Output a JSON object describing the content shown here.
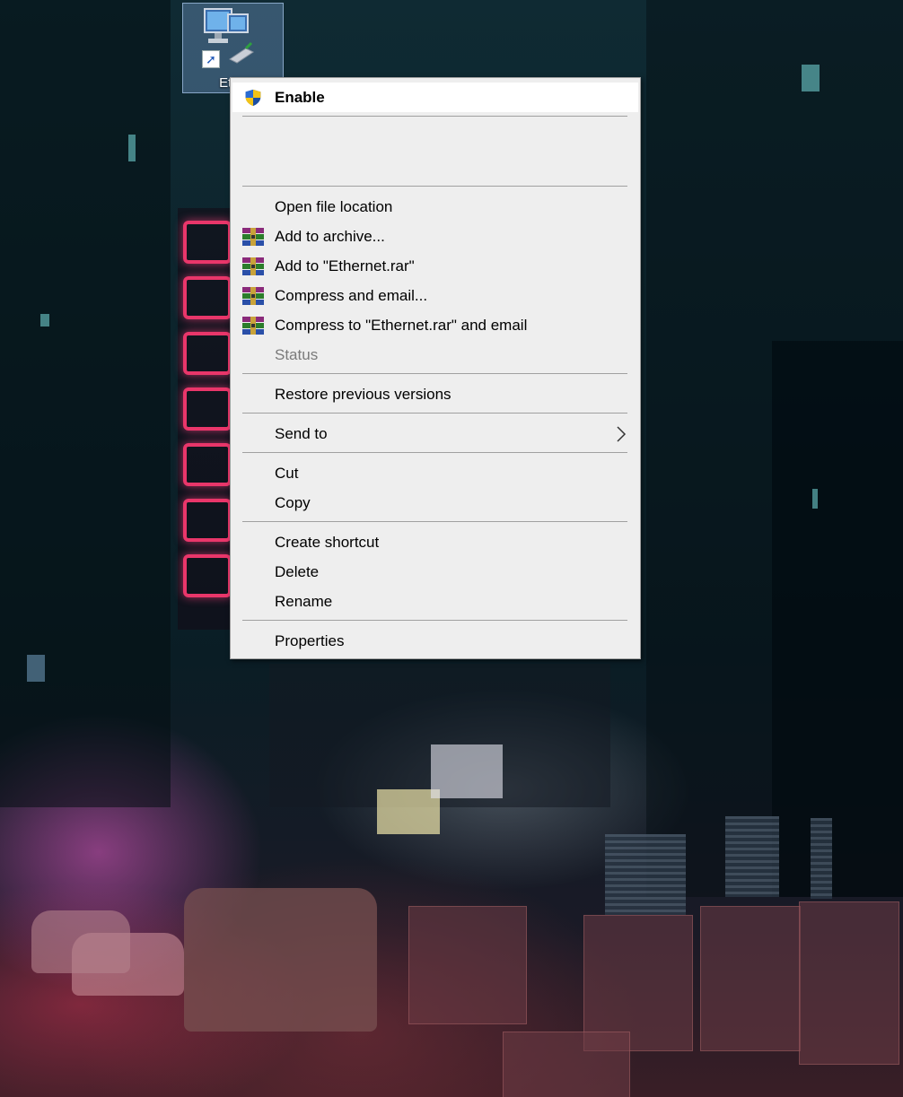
{
  "desktop": {
    "icon_label": "Ethernet",
    "icon_label_visible": "Ethe"
  },
  "context_menu": {
    "items": [
      {
        "label": "Enable",
        "icon": "uac-shield-icon",
        "bold": true,
        "highlighted": true
      },
      {
        "label": "Open file location"
      },
      {
        "label": "Add to archive...",
        "icon": "winrar-icon"
      },
      {
        "label": "Add to \"Ethernet.rar\"",
        "icon": "winrar-icon"
      },
      {
        "label": "Compress and email...",
        "icon": "winrar-icon"
      },
      {
        "label": "Compress to \"Ethernet.rar\" and email",
        "icon": "winrar-icon"
      },
      {
        "label": "Status",
        "disabled": true
      },
      {
        "label": "Restore previous versions"
      },
      {
        "label": "Send to",
        "submenu": true
      },
      {
        "label": "Cut"
      },
      {
        "label": "Copy"
      },
      {
        "label": "Create shortcut"
      },
      {
        "label": "Delete"
      },
      {
        "label": "Rename"
      },
      {
        "label": "Properties"
      }
    ]
  },
  "colors": {
    "menu_background": "#eeeeee",
    "menu_highlight": "#ffffff",
    "separator": "#a0a0a0",
    "disabled_text": "#7a7a7a"
  }
}
